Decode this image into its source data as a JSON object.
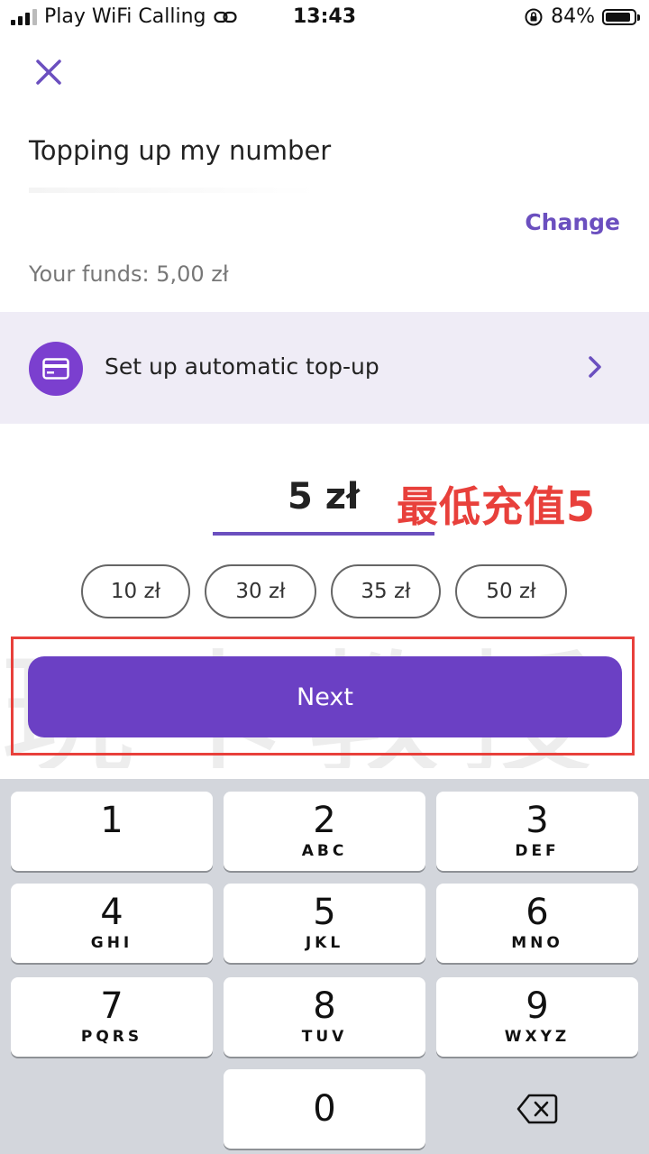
{
  "status_bar": {
    "carrier": "Play WiFi Calling",
    "time": "13:43",
    "battery_percent": "84%"
  },
  "header": {
    "title": "Topping up my number",
    "change_label": "Change",
    "funds": "Your funds: 5,00 zł"
  },
  "auto_topup": {
    "label": "Set up automatic top-up"
  },
  "amount": {
    "value": "5 zł",
    "annotation": "最低充值5"
  },
  "chips": [
    "10 zł",
    "30 zł",
    "35 zł",
    "50 zł"
  ],
  "watermark": "玩卡教授",
  "next_label": "Next",
  "keypad": [
    {
      "num": "1",
      "letters": ""
    },
    {
      "num": "2",
      "letters": "ABC"
    },
    {
      "num": "3",
      "letters": "DEF"
    },
    {
      "num": "4",
      "letters": "GHI"
    },
    {
      "num": "5",
      "letters": "JKL"
    },
    {
      "num": "6",
      "letters": "MNO"
    },
    {
      "num": "7",
      "letters": "PQRS"
    },
    {
      "num": "8",
      "letters": "TUV"
    },
    {
      "num": "9",
      "letters": "WXYZ"
    },
    {
      "num": "0",
      "letters": ""
    }
  ],
  "colors": {
    "accent": "#6b40c4",
    "accent_link": "#6b4fbf",
    "annotation_red": "#e8403b",
    "auto_row_bg": "#efecf6",
    "keyboard_bg": "#d3d6dc"
  }
}
